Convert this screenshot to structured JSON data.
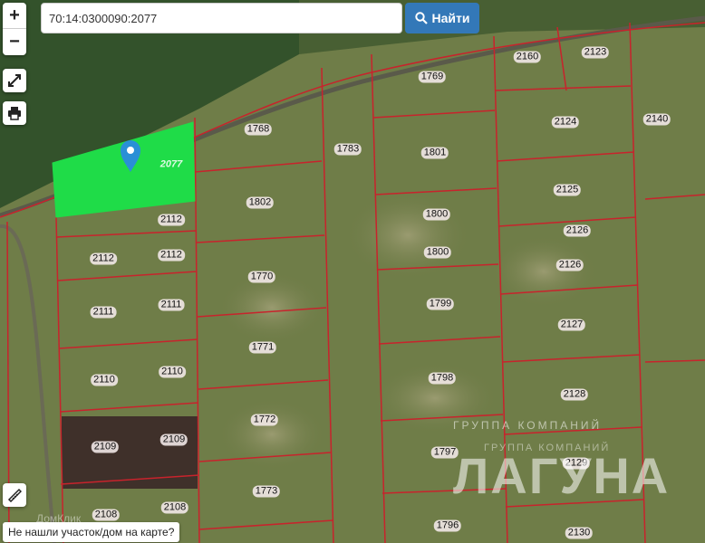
{
  "search": {
    "value": "70:14:0300090:2077",
    "button_label": "Найти"
  },
  "controls": {
    "zoom_in": "+",
    "zoom_out": "−"
  },
  "selected_plot": {
    "label": "2077"
  },
  "plots": [
    {
      "label": "1768"
    },
    {
      "label": "1769"
    },
    {
      "label": "2160"
    },
    {
      "label": "2123"
    },
    {
      "label": "1783"
    },
    {
      "label": "1801"
    },
    {
      "label": "2124"
    },
    {
      "label": "2140"
    },
    {
      "label": "1802"
    },
    {
      "label": "2112"
    },
    {
      "label": "2125"
    },
    {
      "label": "1800"
    },
    {
      "label": "2112"
    },
    {
      "label": "2112"
    },
    {
      "label": "2126"
    },
    {
      "label": "1800"
    },
    {
      "label": "2126"
    },
    {
      "label": "1770"
    },
    {
      "label": "2111"
    },
    {
      "label": "2111"
    },
    {
      "label": "1799"
    },
    {
      "label": "2127"
    },
    {
      "label": "1771"
    },
    {
      "label": "2110"
    },
    {
      "label": "2110"
    },
    {
      "label": "1798"
    },
    {
      "label": "2128"
    },
    {
      "label": "1772"
    },
    {
      "label": "2109"
    },
    {
      "label": "2109"
    },
    {
      "label": "1797"
    },
    {
      "label": "2129"
    },
    {
      "label": "1773"
    },
    {
      "label": "2108"
    },
    {
      "label": "2108"
    },
    {
      "label": "1796"
    },
    {
      "label": "2130"
    }
  ],
  "not_found_link": "Не нашли участок/дом на карте?",
  "watermark": {
    "line1": "ГРУППА КОМПАНИЙ",
    "line2": "ГРУППА КОМПАНИЙ",
    "big": "ЛАГУНА"
  },
  "corner_text": "ДомКлик",
  "colors": {
    "boundary": "#c8232c",
    "selected_fill": "#1fdc48",
    "marker": "#2a8fd6",
    "button": "#3378b8"
  },
  "icons": [
    "fullscreen-icon",
    "print-icon",
    "ruler-icon",
    "map-marker-icon",
    "search-icon"
  ]
}
